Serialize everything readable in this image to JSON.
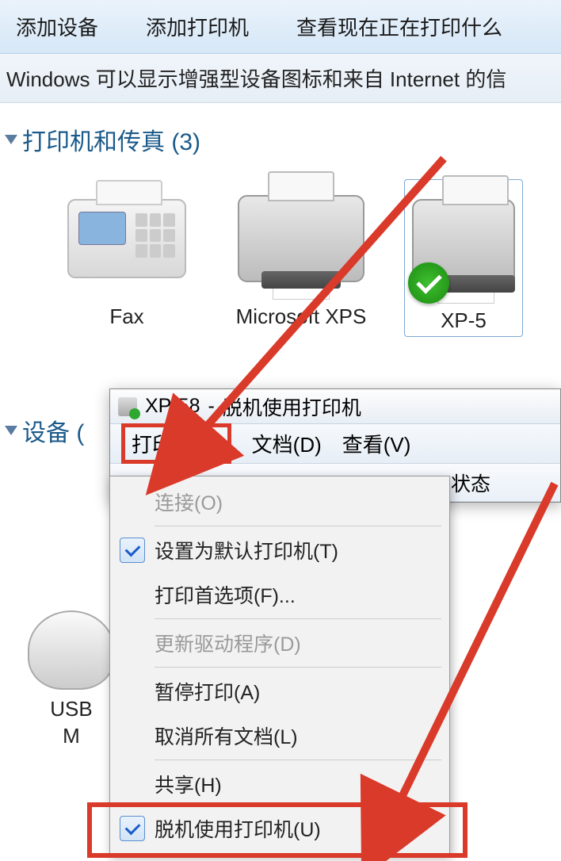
{
  "toolbar": {
    "add_device": "添加设备",
    "add_printer": "添加打印机",
    "view_printing": "查看现在正在打印什么"
  },
  "infobar": {
    "text": "Windows 可以显示增强型设备图标和来自 Internet 的信"
  },
  "sections": {
    "printers_fax": "打印机和传真 (3)",
    "devices": "设备 ("
  },
  "devices": {
    "fax": "Fax",
    "xps": "Microsoft XPS",
    "xp58": "XP-5",
    "usb_line1": "USB",
    "usb_line2": "M"
  },
  "queue": {
    "title_printer": "XP-58",
    "title_sep": " - ",
    "title_status": "脱机使用打印机",
    "menu_printer": "打印机(P)",
    "menu_document": "文档(D)",
    "menu_view": "查看(V)",
    "col_status": "状态"
  },
  "menu": {
    "connect": "连接(O)",
    "set_default": "设置为默认打印机(T)",
    "preferences": "打印首选项(F)...",
    "update_driver": "更新驱动程序(D)",
    "pause": "暂停打印(A)",
    "cancel_all": "取消所有文档(L)",
    "sharing": "共享(H)",
    "use_offline": "脱机使用打印机(U)"
  }
}
